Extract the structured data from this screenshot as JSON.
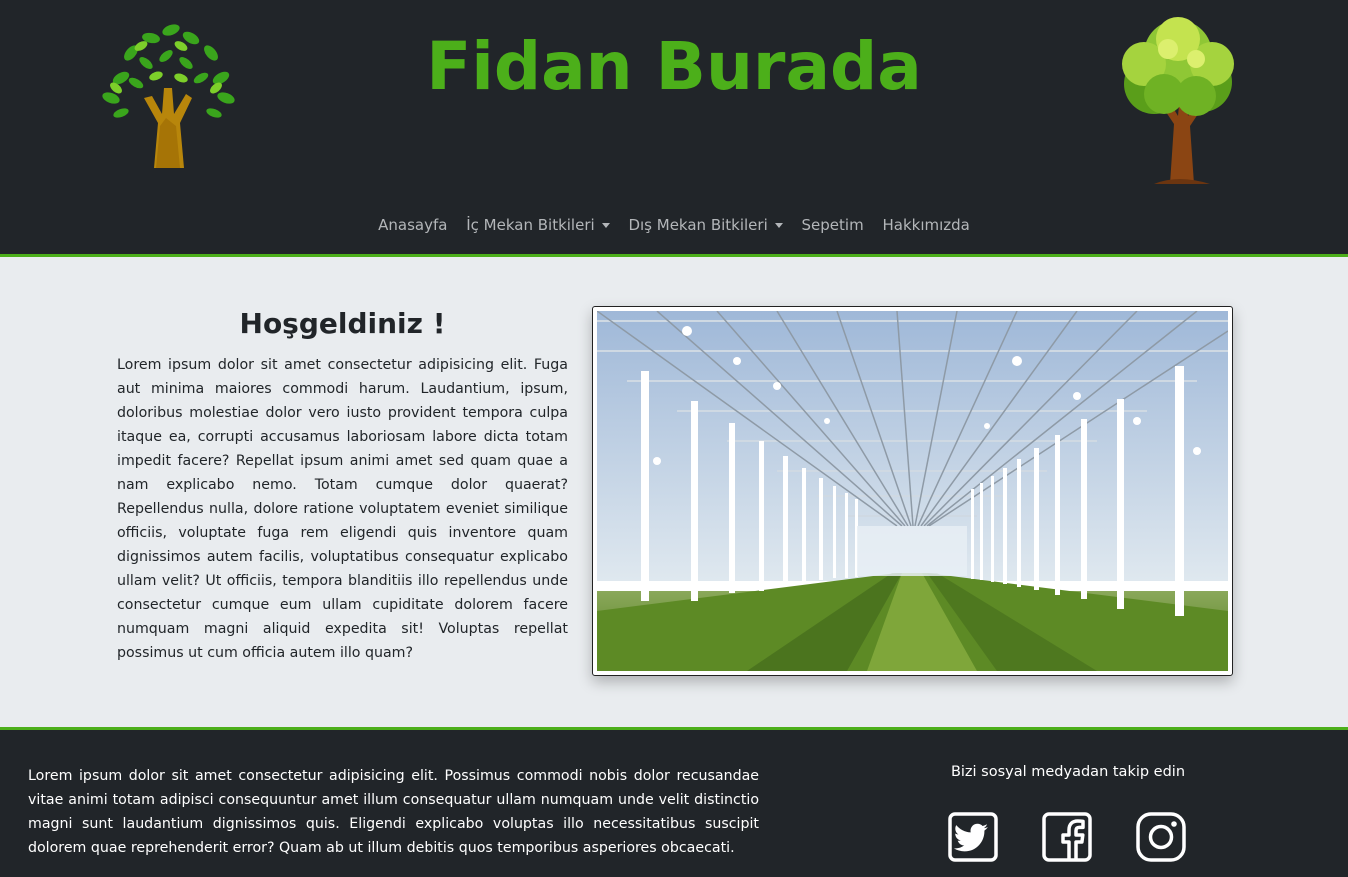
{
  "header": {
    "title": "Fidan Burada",
    "brand_color": "#4caf1a"
  },
  "nav": {
    "items": [
      {
        "label": "Anasayfa",
        "dropdown": false
      },
      {
        "label": "İç Mekan Bitkileri",
        "dropdown": true
      },
      {
        "label": "Dış Mekan Bitkileri",
        "dropdown": true
      },
      {
        "label": "Sepetim",
        "dropdown": false
      },
      {
        "label": "Hakkımızda",
        "dropdown": false
      }
    ]
  },
  "main": {
    "heading": "Hoşgeldiniz !",
    "text": "Lorem ipsum dolor sit amet consectetur adipisicing elit. Fuga aut minima maiores commodi harum. Laudantium, ipsum, doloribus molestiae dolor vero iusto provident tempora culpa itaque ea, corrupti accusamus laboriosam labore dicta totam impedit facere? Repellat ipsum animi amet sed quam quae a nam explicabo nemo. Totam cumque dolor quaerat? Repellendus nulla, dolore ratione voluptatem eveniet similique officiis, voluptate fuga rem eligendi quis inventore quam dignissimos autem facilis, voluptatibus consequatur explicabo ullam velit? Ut officiis, tempora blanditiis illo repellendus unde consectetur cumque eum ullam cupiditate dolorem facere numquam magni aliquid expedita sit! Voluptas repellat possimus ut cum officia autem illo quam?",
    "photo_icon": "greenhouse-photo"
  },
  "footer": {
    "text": "Lorem ipsum dolor sit amet consectetur adipisicing elit. Possimus commodi nobis dolor recusandae vitae animi totam adipisci consequuntur amet illum consequatur ullam numquam unde velit distinctio magni sunt laudantium dignissimos quis. Eligendi explicabo voluptas illo necessitatibus suscipit dolorem quae reprehenderit error? Quam ab ut illum debitis quos temporibus asperiores obcaecati.",
    "social_title": "Bizi sosyal medyadan takip edin",
    "social_icons": [
      "twitter-icon",
      "facebook-icon",
      "instagram-icon"
    ]
  }
}
